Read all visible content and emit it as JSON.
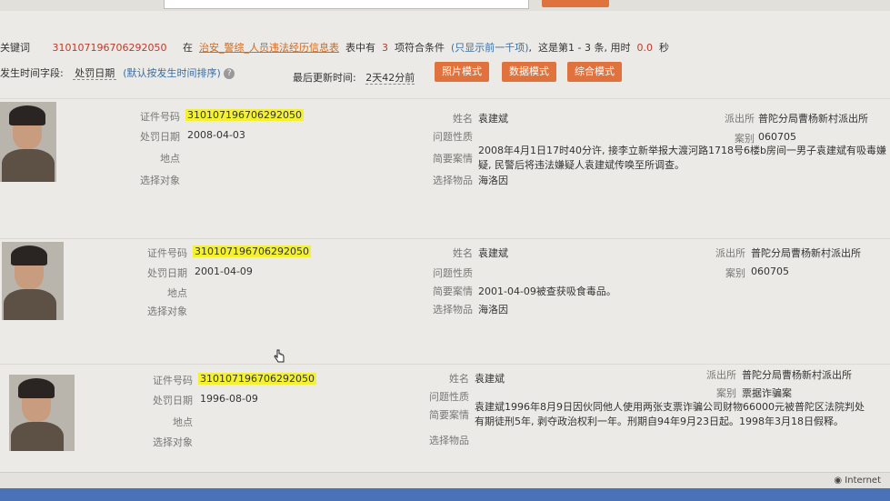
{
  "search": {
    "prefix": "关键词",
    "keyword": "310107196706292050",
    "in_label": "在",
    "table_name": "治安_警综_人员违法经历信息表",
    "mid_text": "表中有",
    "count": "3",
    "count_text": "项符合条件",
    "hint": "(只显示前一千项)",
    "range_text": "这是第1 - 3 条, 用时",
    "time": "0.0",
    "time_unit": "秒"
  },
  "sort": {
    "label": "发生时间字段:",
    "field": "处罚日期",
    "hint": "(默认按发生时间排序)"
  },
  "update": {
    "label": "最后更新时间:",
    "value": "2天42分前"
  },
  "modes": [
    "照片模式",
    "数据模式",
    "综合模式"
  ],
  "labels": {
    "id": "证件号码",
    "date": "处罚日期",
    "place": "地点",
    "target": "选择对象",
    "name": "姓名",
    "nature": "问题性质",
    "summary": "简要案情",
    "item": "选择物品",
    "station": "派出所",
    "case": "案别"
  },
  "records": [
    {
      "id": "310107196706292050",
      "date": "2008-04-03",
      "name": "袁建斌",
      "station": "普陀分局曹杨新村派出所",
      "case": "060705",
      "summary": "2008年4月1日17时40分许, 接李立新举报大渡河路1718号6楼b房间一男子袁建斌有吸毒嫌疑, 民警后将违法嫌疑人袁建斌传唤至所调查。",
      "item": "海洛因"
    },
    {
      "id": "310107196706292050",
      "date": "2001-04-09",
      "name": "袁建斌",
      "station": "普陀分局曹杨新村派出所",
      "case": "060705",
      "summary": "2001-04-09被查获吸食毒品。",
      "item": "海洛因"
    },
    {
      "id": "310107196706292050",
      "date": "1996-08-09",
      "name": "袁建斌",
      "station": "普陀分局曹杨新村派出所",
      "case": "票据诈骗案",
      "summary": "袁建斌1996年8月9日因伙同他人使用两张支票诈骗公司财物66000元被普陀区法院判处有期徒刑5年, 剥夺政治权利一年。刑期自94年9月23日起。1998年3月18日假释。",
      "item": ""
    }
  ],
  "status": {
    "zone": "Internet"
  }
}
